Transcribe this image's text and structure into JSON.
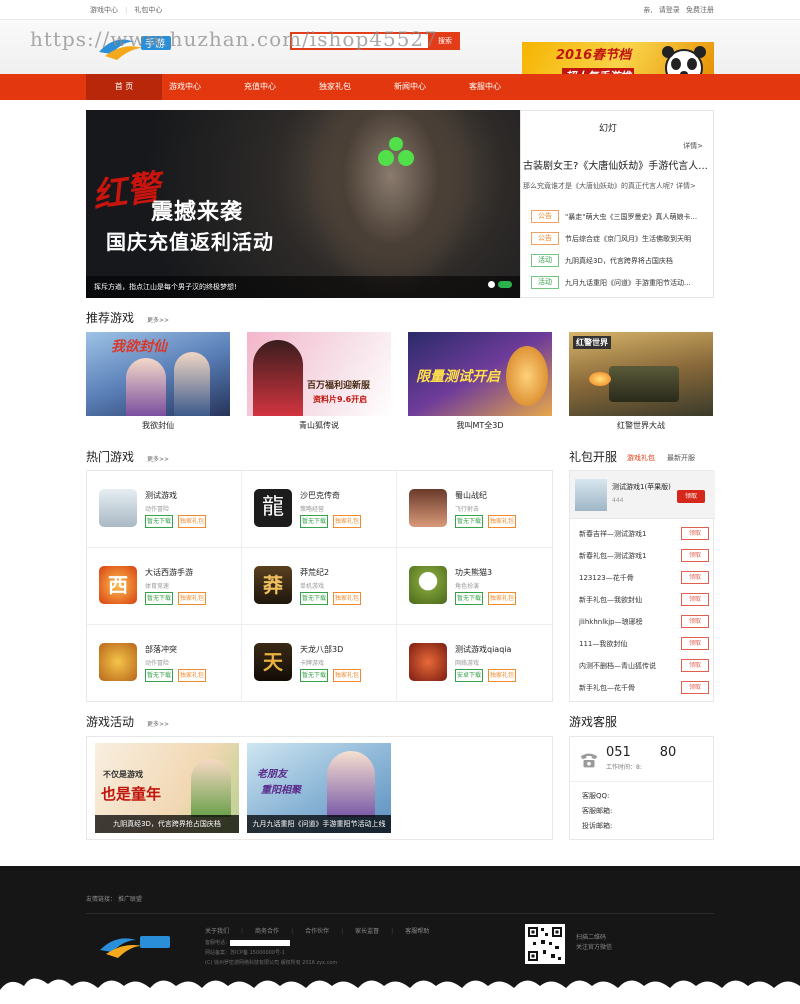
{
  "topbar": {
    "left_links": [
      "游戏中心",
      "礼包中心"
    ],
    "greeting": "亲,",
    "login": "请登录",
    "register": "免费注册"
  },
  "header": {
    "search_placeholder": "",
    "search_button": "搜索",
    "watermark": "https://www.huzhan.com/ishop45527",
    "banner_title": "2016春节档",
    "banner_sub": "超人气手游推"
  },
  "nav": {
    "items": [
      "首 页",
      "游戏中心",
      "充值中心",
      "独家礼包",
      "新闻中心",
      "客服中心"
    ],
    "active_index": 0
  },
  "slider": {
    "title_red": "红警",
    "title_sub": "震撼来袭",
    "title_main": "国庆充值返利活动",
    "caption": "挥斥方遒，指点江山是每个男子汉的终极梦想!"
  },
  "news": {
    "box_title": "幻灯",
    "more": "详情>",
    "headline": "古装剧女王?《大唐仙妖劫》手游代言人...",
    "headline_sub": "那么究竟谁才是《大唐仙妖劫》的真正代言人呢?",
    "headline_more": "详情>",
    "items": [
      {
        "tag": "公告",
        "type": "notice",
        "text": "\"暴走\"萌大虫《三国罗曼史》真人萌娘卡..."
      },
      {
        "tag": "公告",
        "type": "notice",
        "text": "节后综合症《京门风月》生活佛歌到天明"
      },
      {
        "tag": "活动",
        "type": "act",
        "text": "九阴真经3D，代言跨界将占国庆档"
      },
      {
        "tag": "活动",
        "type": "act",
        "text": "九月九话重阳《问道》手游重阳节活动..."
      }
    ]
  },
  "recommend": {
    "title": "推荐游戏",
    "more": "更多>>",
    "games": [
      {
        "name": "我欲封仙",
        "art": "我欲封仙"
      },
      {
        "name": "青山狐传说",
        "art": "百万福利迎新服",
        "art2": "资料片9.6开启"
      },
      {
        "name": "我叫MT全3D",
        "art": "限量测试开启"
      },
      {
        "name": "红警世界大战",
        "art": "红警世界"
      }
    ]
  },
  "hot": {
    "title": "热门游戏",
    "more": "更多>>",
    "download": "暂无下载",
    "gift": "独家礼包",
    "games": [
      {
        "name": "测试游戏",
        "cat": "动作冒险",
        "dl": "暂无下载",
        "color": "#c8d2da"
      },
      {
        "name": "沙巴克传奇",
        "cat": "策略经营",
        "dl": "暂无下载",
        "color": "#2a2a2a",
        "glyph": "龍"
      },
      {
        "name": "蜀山战纪",
        "cat": "飞行射击",
        "dl": "暂无下载",
        "color": "#c88a6a"
      },
      {
        "name": "大话西游手游",
        "cat": "体育竞速",
        "dl": "暂无下载",
        "color": "#e0541a",
        "glyph": "西"
      },
      {
        "name": "莽荒纪2",
        "cat": "单机游戏",
        "dl": "暂无下载",
        "color": "#4a3a22",
        "glyph": "莽"
      },
      {
        "name": "功夫熊猫3",
        "cat": "角色扮演",
        "dl": "暂无下载",
        "color": "#6f8a30"
      },
      {
        "name": "部落冲突",
        "cat": "动作冒险",
        "dl": "暂无下载",
        "color": "#e9a830"
      },
      {
        "name": "天龙八部3D",
        "cat": "卡牌游戏",
        "dl": "暂无下载",
        "color": "#3a2a1a",
        "glyph": "天"
      },
      {
        "name": "测试游戏qiaqia",
        "cat": "网络游戏",
        "dl": "安卓下载",
        "color": "#c23a20"
      }
    ]
  },
  "gifts": {
    "title": "礼包开服",
    "tab_active": "游戏礼包",
    "tab_other": "最新开服",
    "top": {
      "name": "测试游戏1(苹果版)",
      "count": "444",
      "button": "领取"
    },
    "button": "领取",
    "items": [
      "新春吉祥—测试游戏1",
      "新春礼包—测试游戏1",
      "123123—花千骨",
      "新手礼包—我欲封仙",
      "jlihkhnlkjp—琅琊榜",
      "111—我欲封仙",
      "内测不删档—青山狐传说",
      "新手礼包—花千骨"
    ]
  },
  "activities": {
    "title": "游戏活动",
    "more": "更多>>",
    "items": [
      {
        "caption": "九阴真经3D，代言跨界抢占国庆档",
        "art1": "不仅是游戏",
        "art2": "也是童年"
      },
      {
        "caption": "九月九话重阳《问道》手游重阳节活动上线",
        "art1": "老朋友",
        "art2": "重阳相聚"
      }
    ]
  },
  "service": {
    "title": "游戏客服",
    "phone": "051       80",
    "hours": "工作时间：8:",
    "qq": "客服QQ:",
    "email": "客服邮箱:",
    "complaint": "投诉邮箱:"
  },
  "footer": {
    "friend_links_label": "友情链接：",
    "friend_link": "推广联盟",
    "nav": [
      "关于我们",
      "商务合作",
      "合作伙伴",
      "家长监督",
      "客服帮助"
    ],
    "hotline": "客服电话：",
    "license": "网站备案：苏ICP备 15000000号-1",
    "copyright": "(C) 徐州罗密游网络科技有限公司 版权所有 2016 zyx.com",
    "qr_line1": "扫描二维码",
    "qr_line2": "关注官方微信"
  },
  "colors": {
    "brand": "#e3380f",
    "green": "#36a24a",
    "orange": "#f08a2c"
  }
}
